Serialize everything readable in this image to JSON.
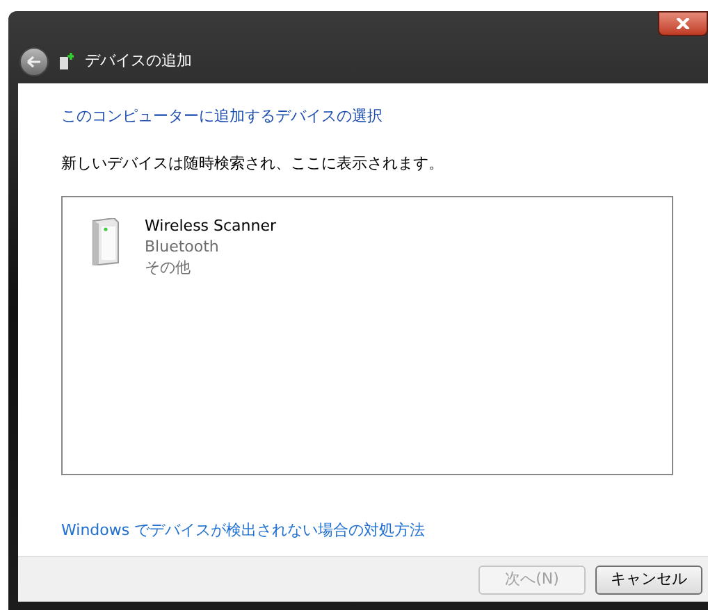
{
  "window": {
    "title": "デバイスの追加"
  },
  "heading": "このコンピューターに追加するデバイスの選択",
  "instruction": "新しいデバイスは随時検索され、ここに表示されます。",
  "devices": [
    {
      "name": "Wireless Scanner",
      "connection": "Bluetooth",
      "category": "その他",
      "selected": false
    }
  ],
  "help_link": "Windows でデバイスが検出されない場合の対処方法",
  "buttons": [
    {
      "label": "次へ(N)",
      "disabled": true
    },
    {
      "label": "キャンセル",
      "disabled": false
    }
  ]
}
